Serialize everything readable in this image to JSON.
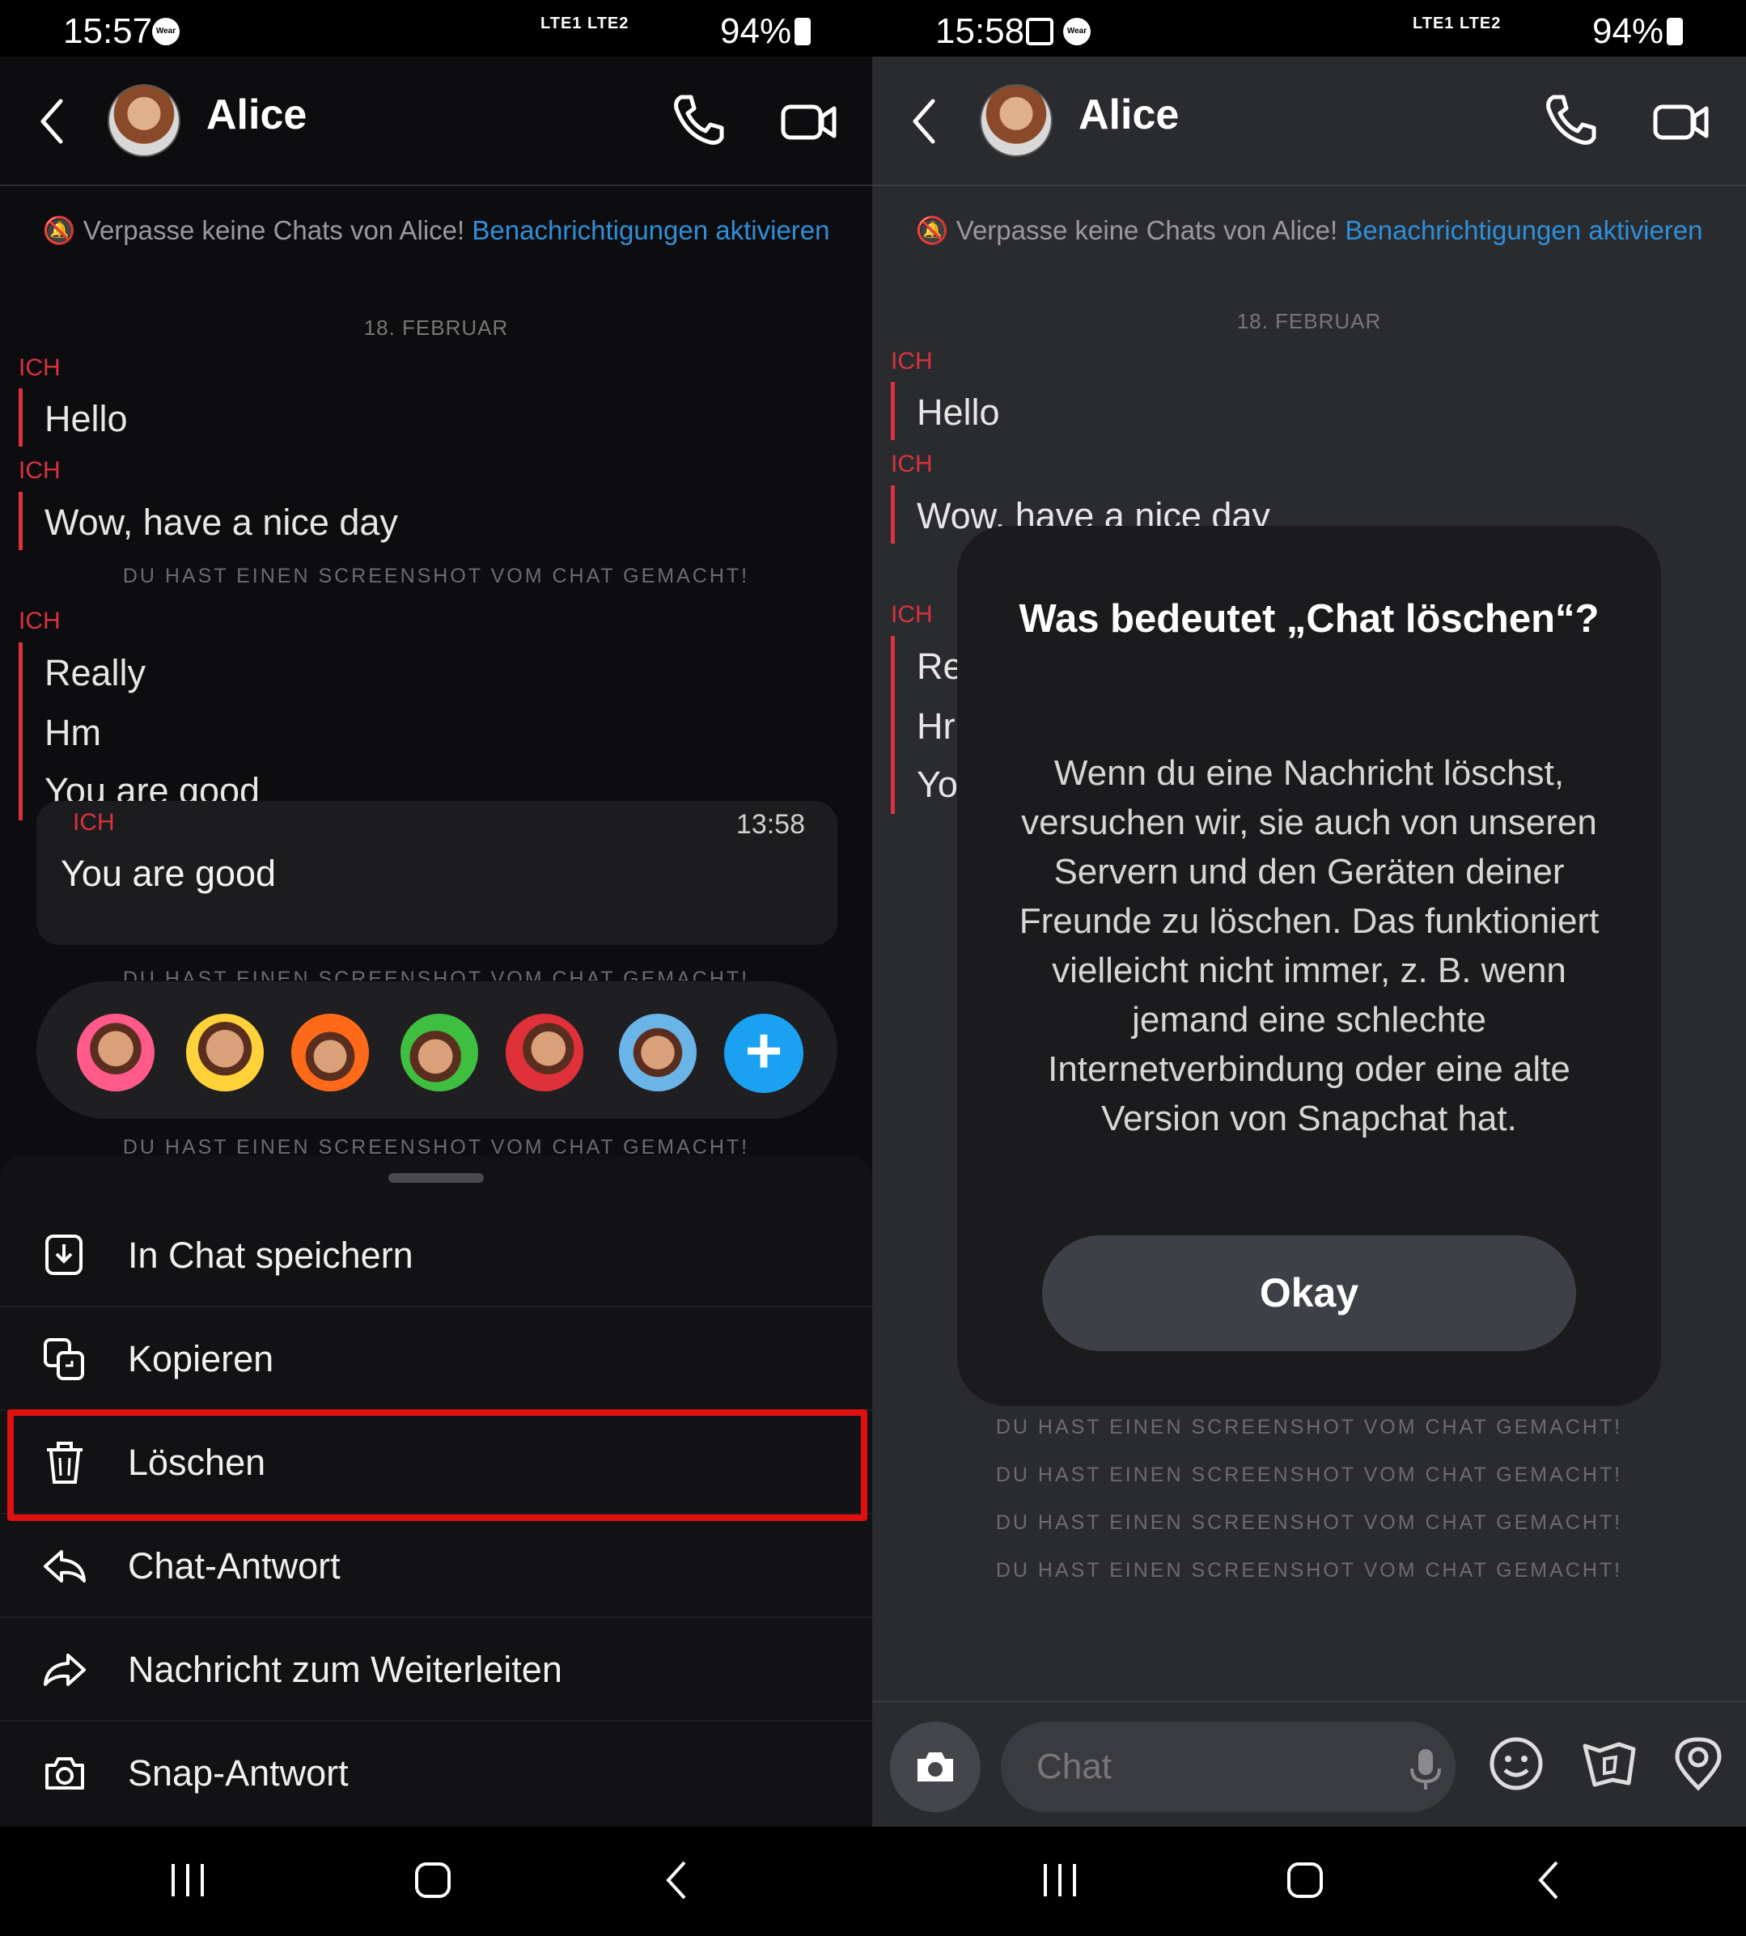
{
  "left": {
    "status": {
      "time": "15:57",
      "wear": "Wear",
      "signal": "LTE1 LTE2",
      "battery": "94%"
    },
    "header": {
      "name": "Alice"
    },
    "notice": {
      "text": "Verpasse keine Chats von Alice! ",
      "link": "Benachrichtigungen aktivieren"
    },
    "date": "18. FEBRUAR",
    "sender": "ICH",
    "messages": [
      "Hello",
      "Wow, have a nice day",
      "Really",
      "Hm",
      "You are good"
    ],
    "screenshot_note": "DU HAST EINEN SCREENSHOT VOM CHAT GEMACHT!",
    "card": {
      "sender": "ICH",
      "time": "13:58",
      "text": "You are good"
    },
    "reactions": [
      "heart-reaction",
      "laugh-cry-reaction",
      "fire-reaction",
      "thumbs-up-reaction",
      "thumbs-down-reaction",
      "sad-reaction"
    ],
    "plus": "+",
    "menu": [
      {
        "label": "In Chat speichern",
        "icon": "save-in-chat-icon"
      },
      {
        "label": "Kopieren",
        "icon": "copy-icon"
      },
      {
        "label": "Löschen",
        "icon": "trash-icon"
      },
      {
        "label": "Chat-Antwort",
        "icon": "reply-icon"
      },
      {
        "label": "Nachricht zum Weiterleiten",
        "icon": "forward-icon"
      },
      {
        "label": "Snap-Antwort",
        "icon": "camera-icon"
      }
    ]
  },
  "right": {
    "status": {
      "time": "15:58",
      "wear": "Wear",
      "signal": "LTE1 LTE2",
      "battery": "94%"
    },
    "header": {
      "name": "Alice"
    },
    "notice": {
      "text": "Verpasse keine Chats von Alice! ",
      "link": "Benachrichtigungen aktivieren"
    },
    "date": "18. FEBRUAR",
    "sender": "ICH",
    "messages": [
      "Hello",
      "Wow, have a nice day",
      "Re",
      "Hr",
      "Yo"
    ],
    "screenshot_note": "DU HAST EINEN SCREENSHOT VOM CHAT GEMACHT!",
    "dialog": {
      "title": "Was bedeutet „Chat löschen“?",
      "body": "Wenn du eine Nachricht löschst, versuchen wir, sie auch von unseren Servern und den Geräten deiner Freunde zu löschen. Das funktioniert vielleicht nicht immer, z. B. wenn jemand eine schlechte Internetverbindung oder eine alte Version von Snapchat hat.",
      "button": "Okay"
    },
    "composer": {
      "placeholder": "Chat"
    }
  },
  "colors": {
    "accent_red": "#d8333f",
    "link_blue": "#2f8fd8",
    "highlight": "#e01010",
    "plus_blue": "#1aa1f2"
  }
}
